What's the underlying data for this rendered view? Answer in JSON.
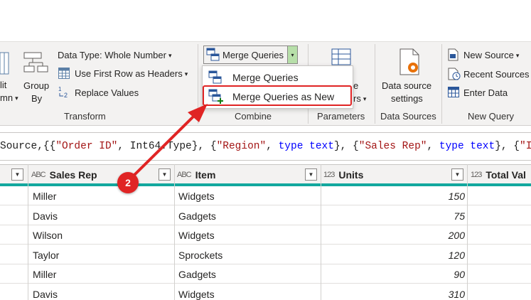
{
  "ribbon": {
    "left_partial": {
      "line1": "lit",
      "line2": "mn",
      "caret": "▾"
    },
    "group_by": {
      "line1": "Group",
      "line2": "By"
    },
    "data_type": {
      "label": "Data Type: Whole Number",
      "caret": "▾"
    },
    "first_row": {
      "label": "Use First Row as Headers",
      "caret": "▾"
    },
    "replace_values": {
      "label": "Replace Values"
    },
    "merge_queries": {
      "label": "Merge Queries",
      "caret": "▾"
    },
    "parameters_partial": {
      "line1": "e",
      "line2": "rs",
      "caret": "▾"
    },
    "data_source_settings": {
      "line1": "Data source",
      "line2": "settings"
    },
    "new_source": {
      "label": "New Source",
      "caret": "▾"
    },
    "recent_sources": {
      "label": "Recent Sources",
      "caret": "▾"
    },
    "enter_data": {
      "label": "Enter Data"
    },
    "groups": {
      "transform": "Transform",
      "combine": "Combine",
      "parameters": "Parameters",
      "data_sources": "Data Sources",
      "new_query": "New Query"
    }
  },
  "menu": {
    "items": [
      {
        "label": "Merge Queries"
      },
      {
        "label": "Merge Queries as New"
      }
    ]
  },
  "formula": {
    "parts": [
      {
        "t": "Source,{{",
        "c": ""
      },
      {
        "t": "\"Order ID\"",
        "c": "str"
      },
      {
        "t": ", Int64.Type}, {",
        "c": ""
      },
      {
        "t": "\"Region\"",
        "c": "str"
      },
      {
        "t": ", ",
        "c": ""
      },
      {
        "t": "type",
        "c": "kw"
      },
      {
        "t": " ",
        "c": ""
      },
      {
        "t": "text",
        "c": "kw"
      },
      {
        "t": "}, {",
        "c": ""
      },
      {
        "t": "\"Sales Rep\"",
        "c": "str"
      },
      {
        "t": ", ",
        "c": ""
      },
      {
        "t": "type",
        "c": "kw"
      },
      {
        "t": " ",
        "c": ""
      },
      {
        "t": "text",
        "c": "kw"
      },
      {
        "t": "}, {",
        "c": ""
      },
      {
        "t": "\"Item",
        "c": "str"
      }
    ]
  },
  "grid": {
    "columns": [
      {
        "type_icon": "ABC",
        "label": "Sales Rep"
      },
      {
        "type_icon": "ABC",
        "label": "Item"
      },
      {
        "type_icon": "123",
        "label": "Units"
      },
      {
        "type_icon": "123",
        "label": "Total Val"
      }
    ],
    "rows": [
      {
        "sales_rep": "Miller",
        "item": "Widgets",
        "units": "150"
      },
      {
        "sales_rep": "Davis",
        "item": "Gadgets",
        "units": "75"
      },
      {
        "sales_rep": "Wilson",
        "item": "Widgets",
        "units": "200"
      },
      {
        "sales_rep": "Taylor",
        "item": "Sprockets",
        "units": "120"
      },
      {
        "sales_rep": "Miller",
        "item": "Gadgets",
        "units": "90"
      },
      {
        "sales_rep": "Davis",
        "item": "Widgets",
        "units": "310"
      }
    ]
  },
  "callout": {
    "number": "2"
  },
  "colors": {
    "accent_teal": "#13a89e",
    "callout_red": "#e02424",
    "split_green": "#b7dfa9"
  }
}
